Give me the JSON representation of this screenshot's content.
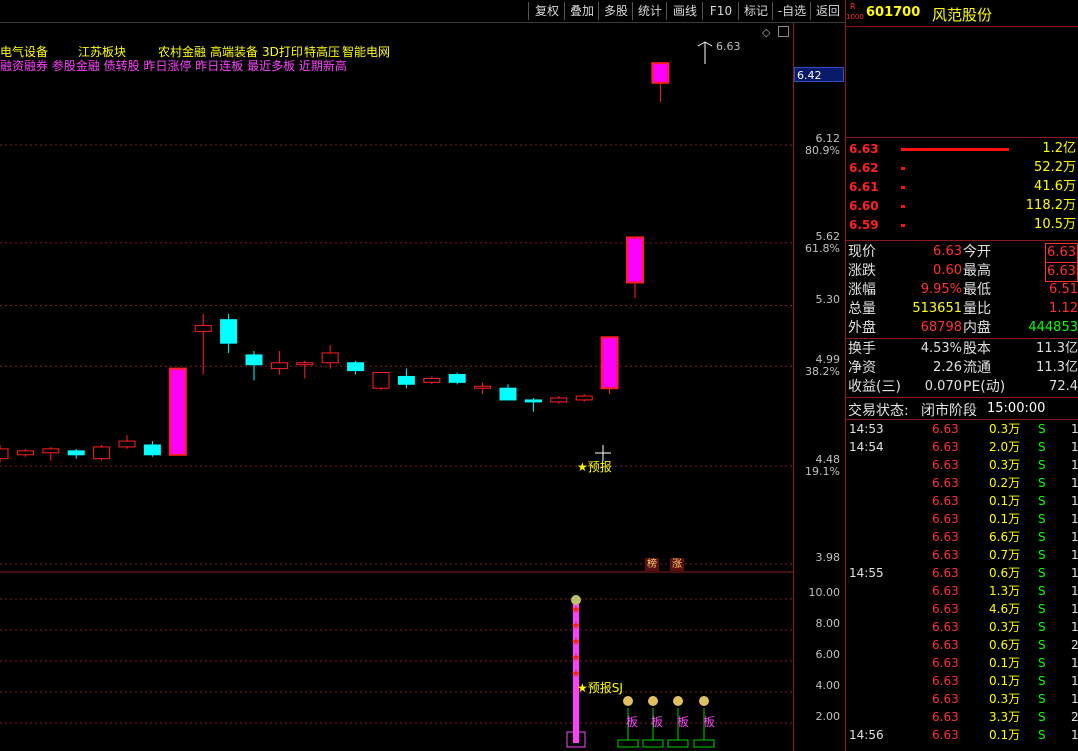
{
  "toolbar": {
    "buttons": [
      "复权",
      "叠加",
      "多股",
      "统计",
      "画线",
      "F10",
      "标记",
      "-自选",
      "返回"
    ]
  },
  "header": {
    "badge_top": "R",
    "badge_bottom": "1000",
    "stock_code": "601700",
    "stock_name": "风范股份"
  },
  "concept_tags_row1": [
    "电气设备",
    "江苏板块",
    "农村金融",
    "高端装备",
    "3D打印",
    "特高压",
    "智能电网"
  ],
  "concept_tags_row2": "融资融券 参股金融 债转股 昨日涨停 昨日连板 最近多板 近期新高",
  "price_axis": {
    "current_marker": "6.42",
    "peak_label": "6.63",
    "levels": [
      {
        "price": "6.12",
        "pct": "80.9%"
      },
      {
        "price": "5.62",
        "pct": "61.8%"
      },
      {
        "price": "5.30",
        "pct": ""
      },
      {
        "price": "4.99",
        "pct": "38.2%"
      },
      {
        "price": "4.48",
        "pct": "19.1%"
      },
      {
        "price": "3.98",
        "pct": ""
      }
    ]
  },
  "indicator_axis": [
    "10.00",
    "8.00",
    "6.00",
    "4.00",
    "2.00"
  ],
  "chart_labels": {
    "forecast": "★预报",
    "forecast_sj": "★预报SJ",
    "rank_badge": "榜",
    "rise_badge": "涨",
    "board_label": "板"
  },
  "chart_data": {
    "type": "candlestick",
    "ylim": [
      3.98,
      6.63
    ],
    "candles": [
      {
        "o": 4.38,
        "c": 4.43,
        "h": 4.45,
        "l": 4.36,
        "up": true
      },
      {
        "o": 4.4,
        "c": 4.42,
        "h": 4.43,
        "l": 4.39,
        "up": true
      },
      {
        "o": 4.41,
        "c": 4.43,
        "h": 4.44,
        "l": 4.37,
        "up": true
      },
      {
        "o": 4.42,
        "c": 4.4,
        "h": 4.43,
        "l": 4.38,
        "up": false
      },
      {
        "o": 4.38,
        "c": 4.44,
        "h": 4.45,
        "l": 4.37,
        "up": true
      },
      {
        "o": 4.44,
        "c": 4.47,
        "h": 4.5,
        "l": 4.43,
        "up": true
      },
      {
        "o": 4.45,
        "c": 4.4,
        "h": 4.47,
        "l": 4.39,
        "up": false
      },
      {
        "o": 4.4,
        "c": 4.84,
        "h": 4.84,
        "l": 4.4,
        "up": true
      },
      {
        "o": 5.03,
        "c": 5.06,
        "h": 5.12,
        "l": 4.81,
        "up": true
      },
      {
        "o": 5.09,
        "c": 4.97,
        "h": 5.12,
        "l": 4.92,
        "up": false
      },
      {
        "o": 4.91,
        "c": 4.86,
        "h": 4.93,
        "l": 4.78,
        "up": false
      },
      {
        "o": 4.84,
        "c": 4.87,
        "h": 4.93,
        "l": 4.81,
        "up": true
      },
      {
        "o": 4.86,
        "c": 4.87,
        "h": 4.88,
        "l": 4.79,
        "up": true
      },
      {
        "o": 4.87,
        "c": 4.92,
        "h": 4.96,
        "l": 4.84,
        "up": true
      },
      {
        "o": 4.87,
        "c": 4.83,
        "h": 4.88,
        "l": 4.81,
        "up": false
      },
      {
        "o": 4.74,
        "c": 4.82,
        "h": 4.82,
        "l": 4.73,
        "up": true
      },
      {
        "o": 4.8,
        "c": 4.76,
        "h": 4.84,
        "l": 4.74,
        "up": false
      },
      {
        "o": 4.77,
        "c": 4.79,
        "h": 4.8,
        "l": 4.76,
        "up": true
      },
      {
        "o": 4.81,
        "c": 4.77,
        "h": 4.82,
        "l": 4.76,
        "up": false
      },
      {
        "o": 4.74,
        "c": 4.75,
        "h": 4.77,
        "l": 4.71,
        "up": true
      },
      {
        "o": 4.74,
        "c": 4.68,
        "h": 4.76,
        "l": 4.68,
        "up": false
      },
      {
        "o": 4.68,
        "c": 4.67,
        "h": 4.69,
        "l": 4.62,
        "up": false
      },
      {
        "o": 4.67,
        "c": 4.69,
        "h": 4.7,
        "l": 4.66,
        "up": true
      },
      {
        "o": 4.68,
        "c": 4.7,
        "h": 4.71,
        "l": 4.67,
        "up": true
      },
      {
        "o": 4.74,
        "c": 5.0,
        "h": 5.0,
        "l": 4.71,
        "up": true
      },
      {
        "o": 5.28,
        "c": 5.51,
        "h": 5.51,
        "l": 5.2,
        "up": true
      },
      {
        "o": 6.3,
        "c": 6.4,
        "h": 6.4,
        "l": 6.2,
        "up": true
      }
    ]
  },
  "order_book": [
    {
      "price": "6.63",
      "vol": "1.2亿",
      "bar": 0.6
    },
    {
      "price": "6.62",
      "vol": "52.2万",
      "bar": 0.02
    },
    {
      "price": "6.61",
      "vol": "41.6万",
      "bar": 0.02
    },
    {
      "price": "6.60",
      "vol": "118.2万",
      "bar": 0.02
    },
    {
      "price": "6.59",
      "vol": "10.5万",
      "bar": 0.02
    }
  ],
  "quote": [
    {
      "l1": "现价",
      "v1": "6.63",
      "c1": "red",
      "l2": "今开",
      "v2": "6.63",
      "c2": "red",
      "box2": true
    },
    {
      "l1": "涨跌",
      "v1": "0.60",
      "c1": "red",
      "l2": "最高",
      "v2": "6.63",
      "c2": "red",
      "box2": true
    },
    {
      "l1": "涨幅",
      "v1": "9.95%",
      "c1": "red",
      "l2": "最低",
      "v2": "6.51",
      "c2": "red",
      "box2": false
    },
    {
      "l1": "总量",
      "v1": "513651",
      "c1": "yel",
      "l2": "量比",
      "v2": "1.12",
      "c2": "red",
      "box2": false
    },
    {
      "l1": "外盘",
      "v1": "68798",
      "c1": "red",
      "l2": "内盘",
      "v2": "444853",
      "c2": "grn",
      "box2": false
    },
    {
      "l1": "换手",
      "v1": "4.53%",
      "c1": "wht",
      "l2": "股本",
      "v2": "11.3亿",
      "c2": "wht",
      "box2": false
    },
    {
      "l1": "净资",
      "v1": "2.26",
      "c1": "wht",
      "l2": "流通",
      "v2": "11.3亿",
      "c2": "wht",
      "box2": false
    },
    {
      "l1": "收益(三)",
      "v1": "0.070",
      "c1": "wht",
      "l2": "PE(动)",
      "v2": "72.4",
      "c2": "wht",
      "box2": false
    }
  ],
  "trade_status": {
    "label": "交易状态:",
    "value": "闭市阶段",
    "time": "15:00:00"
  },
  "trades": [
    {
      "time": "14:53",
      "price": "6.63",
      "vol": "0.3万",
      "side": "S",
      "n": "1"
    },
    {
      "time": "14:54",
      "price": "6.63",
      "vol": "2.0万",
      "side": "S",
      "n": "1"
    },
    {
      "time": "",
      "price": "6.63",
      "vol": "0.3万",
      "side": "S",
      "n": "1"
    },
    {
      "time": "",
      "price": "6.63",
      "vol": "0.2万",
      "side": "S",
      "n": "1"
    },
    {
      "time": "",
      "price": "6.63",
      "vol": "0.1万",
      "side": "S",
      "n": "1"
    },
    {
      "time": "",
      "price": "6.63",
      "vol": "0.1万",
      "side": "S",
      "n": "1"
    },
    {
      "time": "",
      "price": "6.63",
      "vol": "6.6万",
      "side": "S",
      "n": "1"
    },
    {
      "time": "",
      "price": "6.63",
      "vol": "0.7万",
      "side": "S",
      "n": "1"
    },
    {
      "time": "14:55",
      "price": "6.63",
      "vol": "0.6万",
      "side": "S",
      "n": "1"
    },
    {
      "time": "",
      "price": "6.63",
      "vol": "1.3万",
      "side": "S",
      "n": "1"
    },
    {
      "time": "",
      "price": "6.63",
      "vol": "4.6万",
      "side": "S",
      "n": "1"
    },
    {
      "time": "",
      "price": "6.63",
      "vol": "0.3万",
      "side": "S",
      "n": "1"
    },
    {
      "time": "",
      "price": "6.63",
      "vol": "0.6万",
      "side": "S",
      "n": "2"
    },
    {
      "time": "",
      "price": "6.63",
      "vol": "0.1万",
      "side": "S",
      "n": "1"
    },
    {
      "time": "",
      "price": "6.63",
      "vol": "0.1万",
      "side": "S",
      "n": "1"
    },
    {
      "time": "",
      "price": "6.63",
      "vol": "0.3万",
      "side": "S",
      "n": "1"
    },
    {
      "time": "",
      "price": "6.63",
      "vol": "3.3万",
      "side": "S",
      "n": "2"
    },
    {
      "time": "14:56",
      "price": "6.63",
      "vol": "0.1万",
      "side": "S",
      "n": "1"
    }
  ],
  "colors": {
    "up": "#ff00ff",
    "down": "#00ffff",
    "rise_red": "#ff2020"
  }
}
